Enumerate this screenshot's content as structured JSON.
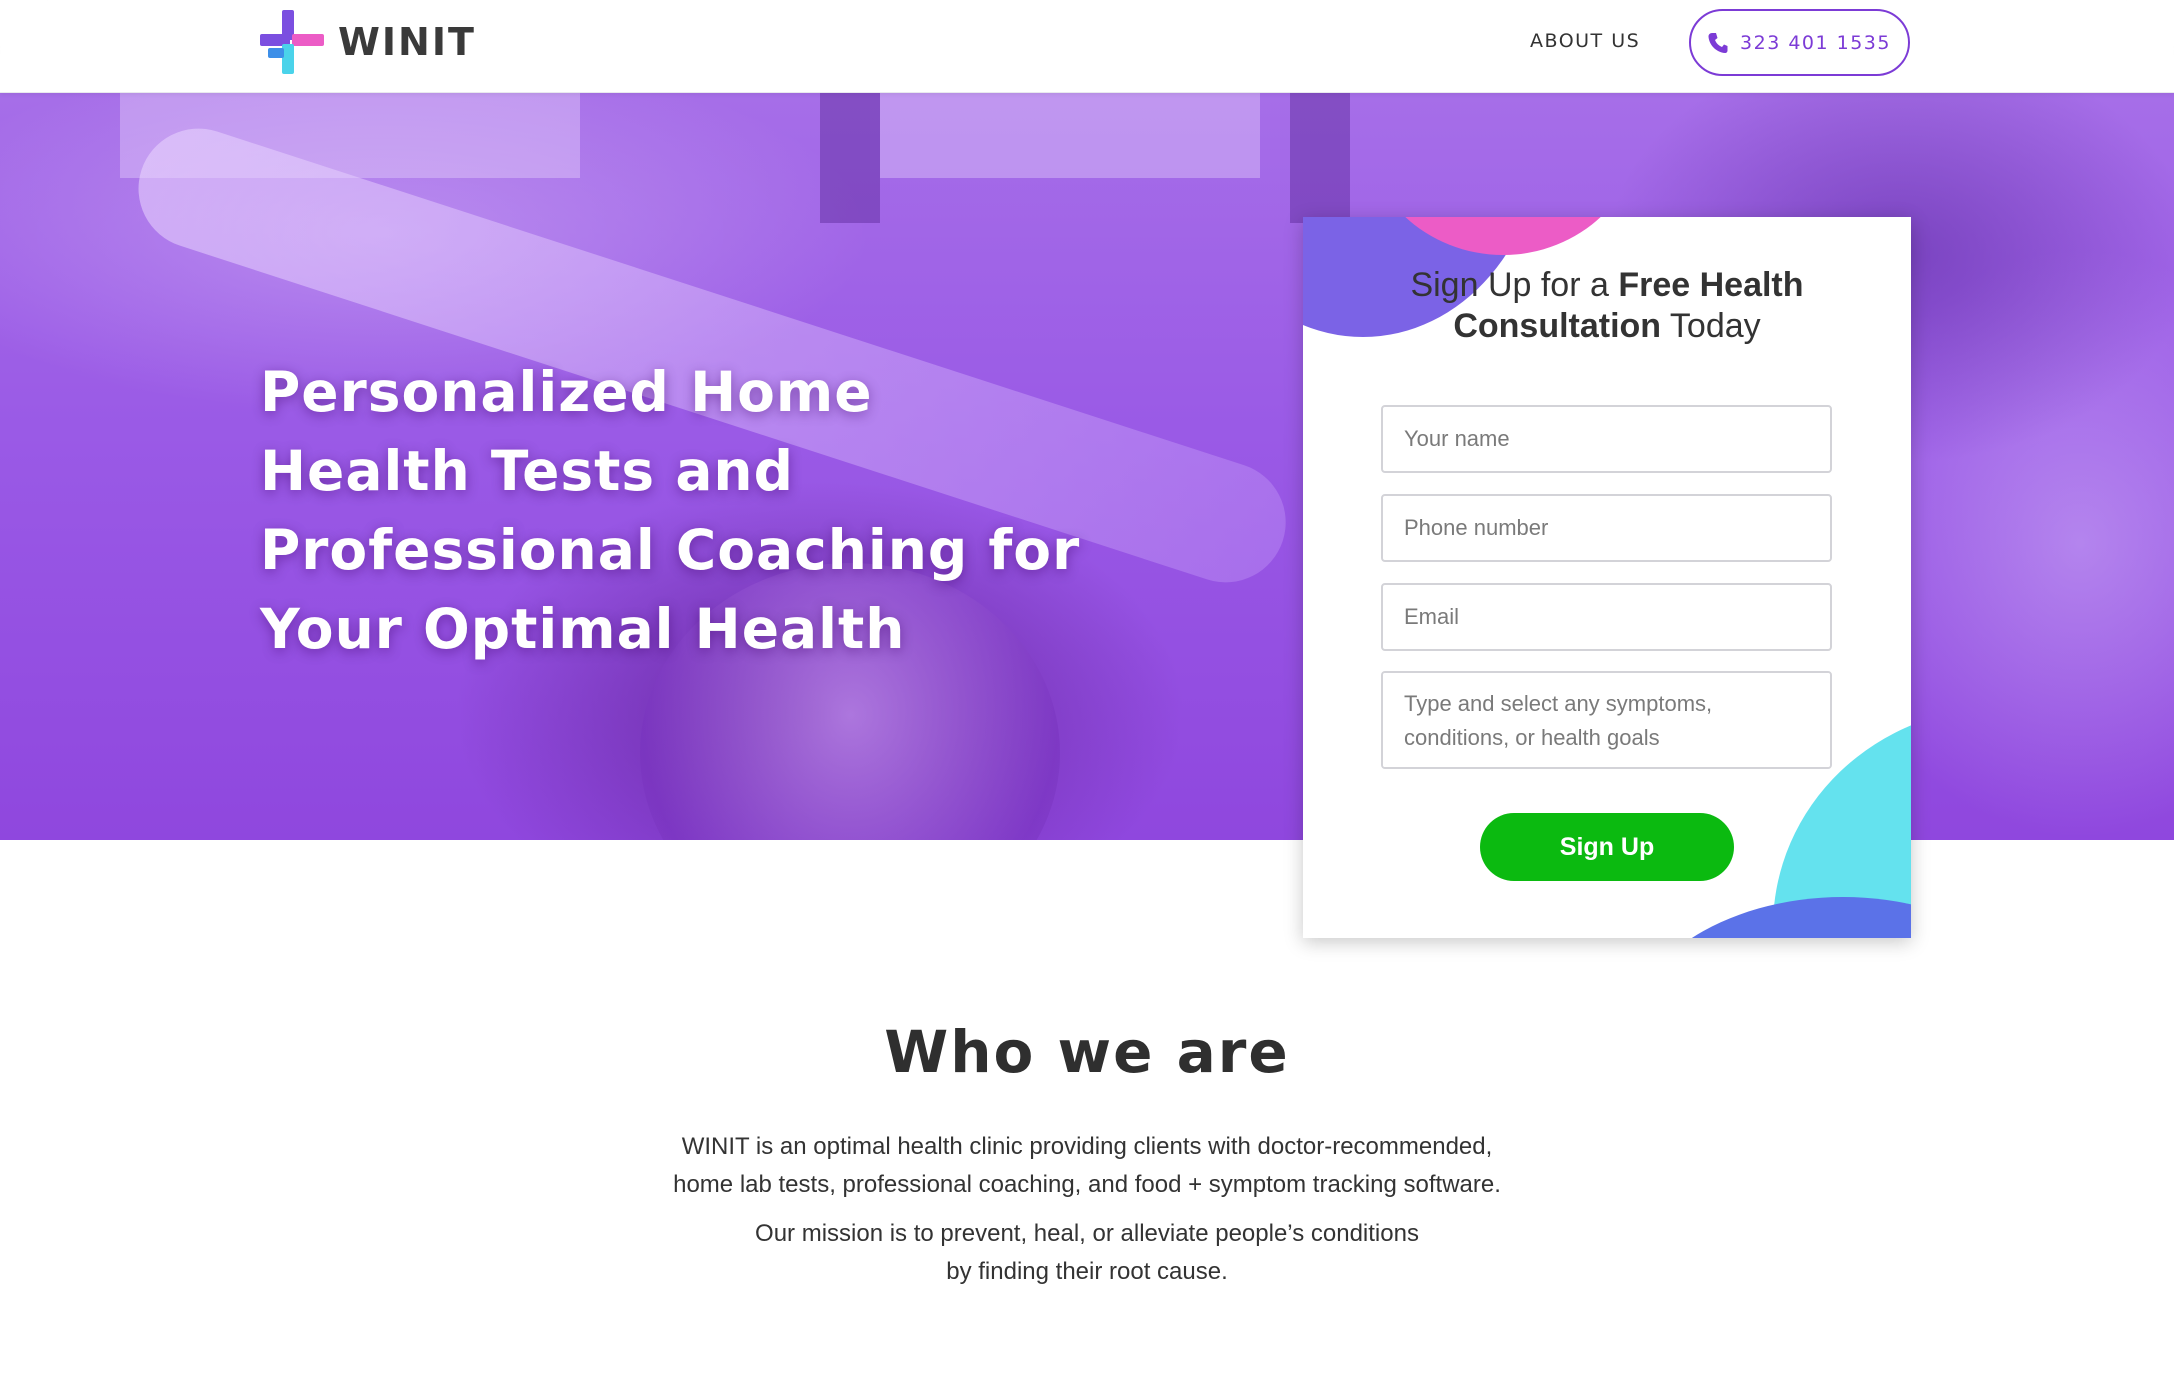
{
  "header": {
    "brand": "WINIT",
    "nav_about": "ABOUT US",
    "phone": "323 401 1535"
  },
  "hero": {
    "title": "Personalized Home Health Tests and Professional Coaching for Your Optimal Health"
  },
  "signup": {
    "title_pre": "Sign Up for a ",
    "title_bold": "Free Health Consultation",
    "title_post": " Today",
    "name_placeholder": "Your name",
    "phone_placeholder": "Phone number",
    "email_placeholder": "Email",
    "symptoms_placeholder": "Type and select any symptoms, conditions, or health goals",
    "button_label": "Sign Up"
  },
  "about": {
    "title": "Who we are",
    "line1": "WINIT is an optimal health clinic providing clients with doctor-recommended,",
    "line2": "home lab tests, professional coaching, and food + symptom tracking software.",
    "line3": "Our mission is to prevent, heal, or alleviate people’s conditions",
    "line4": "by finding their root cause."
  },
  "colors": {
    "accent_purple": "#7c3bd6",
    "hero_purple": "#9a5ae6",
    "button_green": "#0bba10",
    "blob_pink": "#ec5cc6",
    "blob_cyan": "#64e2ee",
    "blob_blue": "#4a6ee8"
  },
  "icons": {
    "logo": "winit-cross-logo-icon",
    "phone": "phone-icon"
  }
}
